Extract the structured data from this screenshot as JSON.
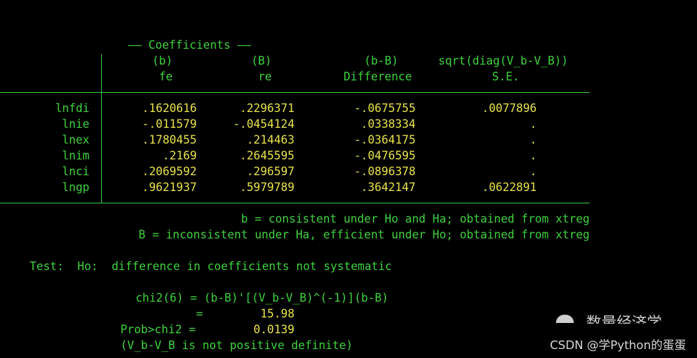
{
  "header": {
    "group": "—— Coefficients ——",
    "cols": [
      {
        "top": "(b)",
        "bottom": "fe"
      },
      {
        "top": "(B)",
        "bottom": "re"
      },
      {
        "top": "(b-B)",
        "bottom": "Difference"
      },
      {
        "top": "sqrt(diag(V_b-V_B))",
        "bottom": "S.E."
      }
    ]
  },
  "rows": [
    {
      "var": "lnfdi",
      "b": ".1620616",
      "B": ".2296371",
      "diff": "-.0675755",
      "se": ".0077896"
    },
    {
      "var": "lnie",
      "b": "-.011579",
      "B": "-.0454124",
      "diff": ".0338334",
      "se": "."
    },
    {
      "var": "lnex",
      "b": ".1780455",
      "B": ".214463",
      "diff": "-.0364175",
      "se": "."
    },
    {
      "var": "lnim",
      "b": ".2169",
      "B": ".2645595",
      "diff": "-.0476595",
      "se": "."
    },
    {
      "var": "lnci",
      "b": ".2069592",
      "B": ".296597",
      "diff": "-.0896378",
      "se": "."
    },
    {
      "var": "lngp",
      "b": ".9621937",
      "B": ".5979789",
      "diff": ".3642147",
      "se": ".0622891"
    }
  ],
  "notes": {
    "line1": "b = consistent under Ho and Ha; obtained from xtreg",
    "line2": "B = inconsistent under Ha, efficient under Ho; obtained from xtreg"
  },
  "test": {
    "label": "Test:  Ho:  difference in coefficients not systematic",
    "chi2_label": "chi2(6) = (b-B)'[(V_b-V_B)^(-1)](b-B)",
    "eq": "=",
    "chi2_value": "15.98",
    "prob_label": "Prob>chi2 =",
    "prob_value": "0.0139",
    "note": "(V_b-V_B is not positive definite)"
  },
  "watermark": {
    "text": "CSDN @学Python的蛋蛋",
    "partial": "数量经济学"
  },
  "colors": {
    "background": "#000000",
    "text": "#3fd23f",
    "value": "#e8e24a"
  }
}
